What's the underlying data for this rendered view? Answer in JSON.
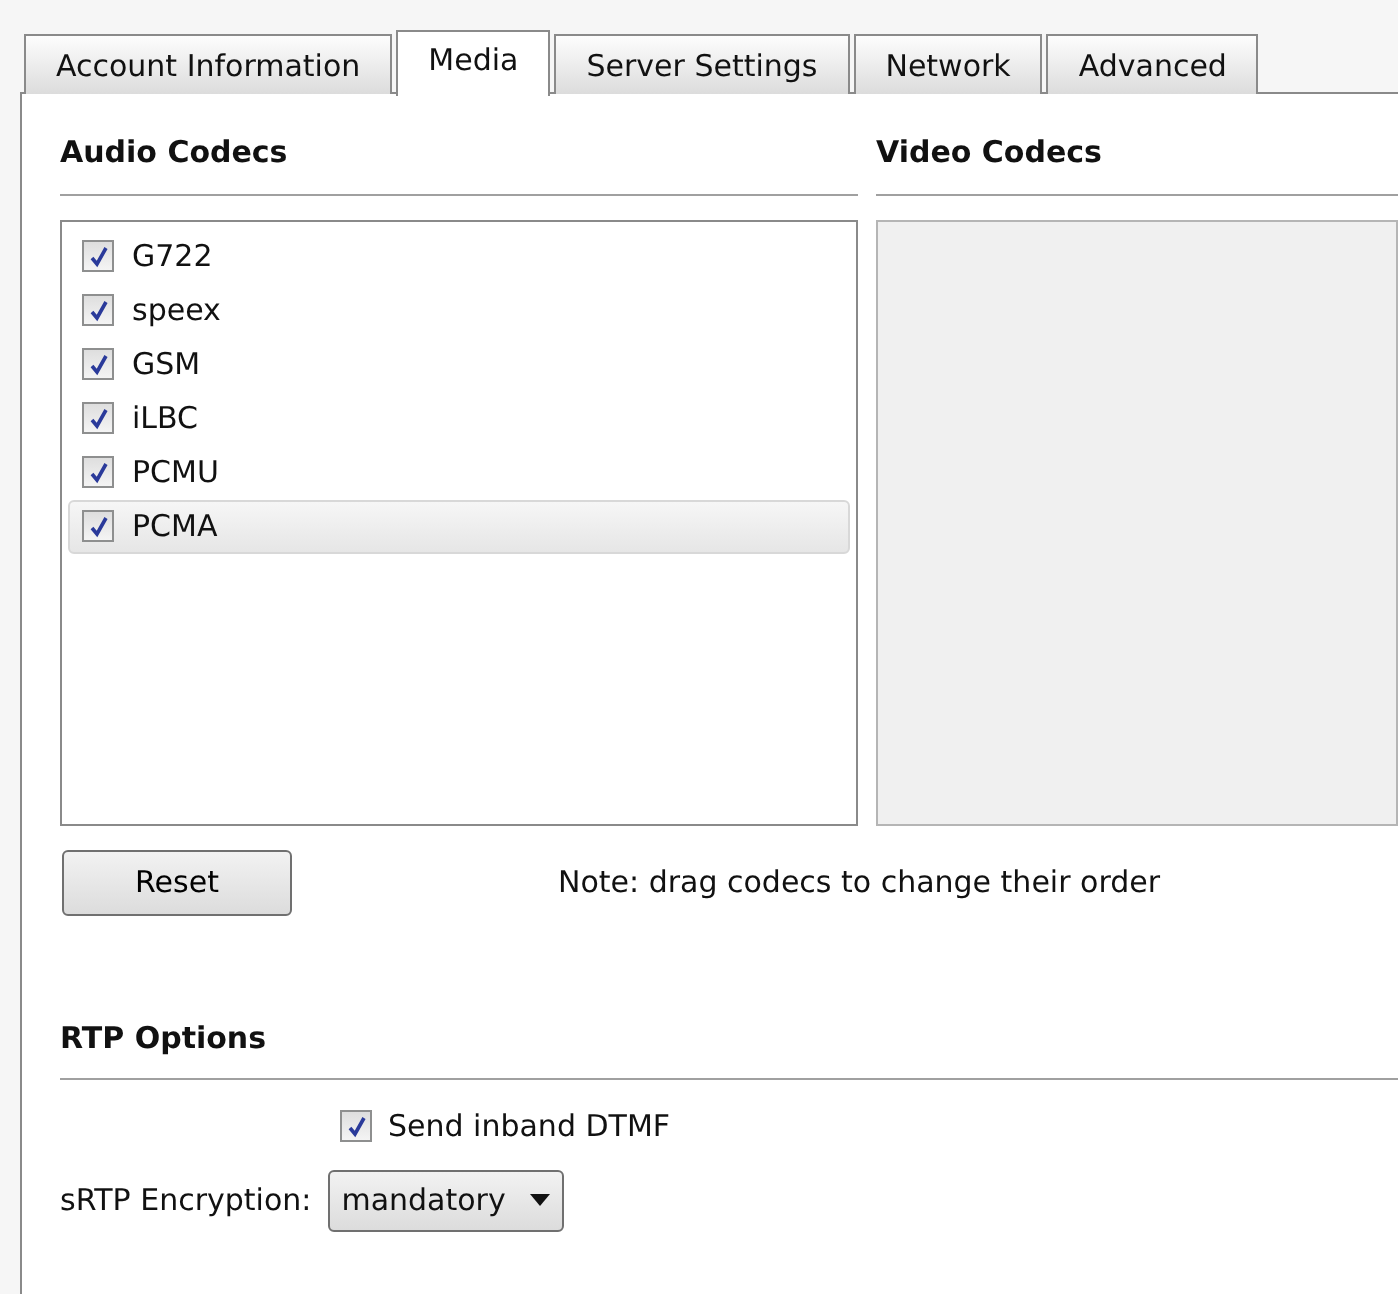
{
  "tabs": [
    {
      "label": "Account Information",
      "selected": false
    },
    {
      "label": "Media",
      "selected": true
    },
    {
      "label": "Server Settings",
      "selected": false
    },
    {
      "label": "Network",
      "selected": false
    },
    {
      "label": "Advanced",
      "selected": false
    }
  ],
  "audio_codecs": {
    "title": "Audio Codecs",
    "items": [
      {
        "name": "G722",
        "checked": true,
        "selected": false
      },
      {
        "name": "speex",
        "checked": true,
        "selected": false
      },
      {
        "name": "GSM",
        "checked": true,
        "selected": false
      },
      {
        "name": "iLBC",
        "checked": true,
        "selected": false
      },
      {
        "name": "PCMU",
        "checked": true,
        "selected": false
      },
      {
        "name": "PCMA",
        "checked": true,
        "selected": true
      }
    ]
  },
  "video_codecs": {
    "title": "Video Codecs"
  },
  "reset_button": "Reset",
  "note": "Note: drag codecs to change their order",
  "rtp_options": {
    "title": "RTP Options",
    "send_inband_dtmf": {
      "label": "Send inband DTMF",
      "checked": true
    },
    "srtp_encryption": {
      "label": "sRTP Encryption:",
      "value": "mandatory"
    }
  }
}
